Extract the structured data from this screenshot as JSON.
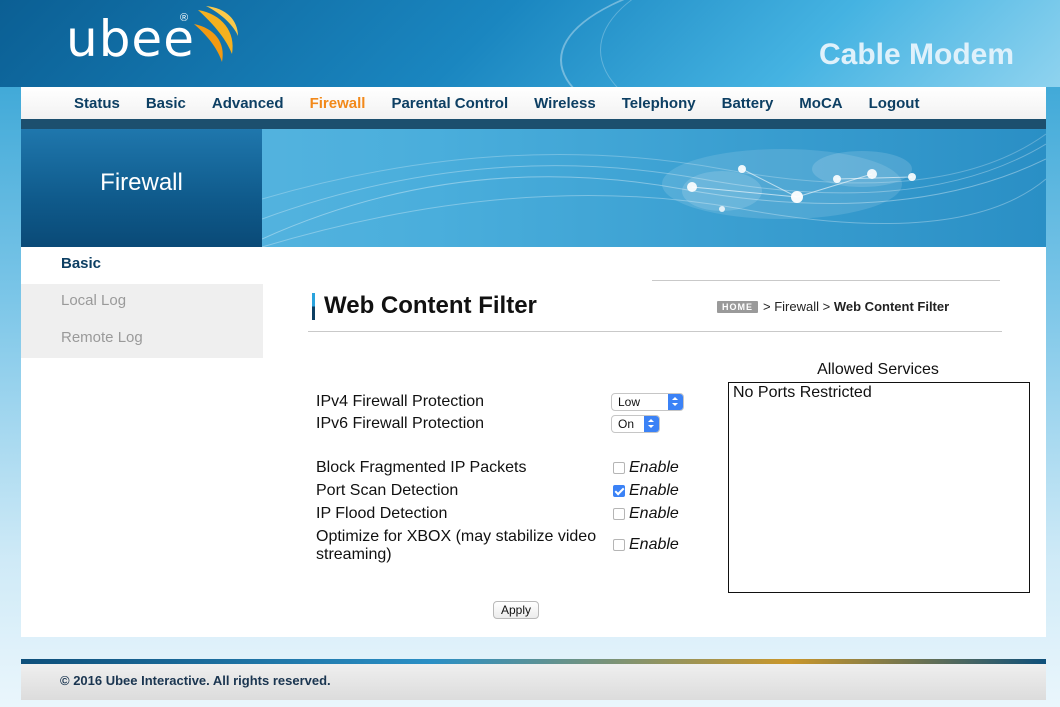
{
  "header": {
    "logo_text": "ubee",
    "logo_reg": "®",
    "product_title": "Cable Modem"
  },
  "nav": {
    "items": [
      {
        "label": "Status",
        "active": false
      },
      {
        "label": "Basic",
        "active": false
      },
      {
        "label": "Advanced",
        "active": false
      },
      {
        "label": "Firewall",
        "active": true
      },
      {
        "label": "Parental Control",
        "active": false
      },
      {
        "label": "Wireless",
        "active": false
      },
      {
        "label": "Telephony",
        "active": false
      },
      {
        "label": "Battery",
        "active": false
      },
      {
        "label": "MoCA",
        "active": false
      },
      {
        "label": "Logout",
        "active": false
      }
    ],
    "active_color": "#f2891a"
  },
  "banner": {
    "section_title": "Firewall"
  },
  "sidebar": {
    "items": [
      {
        "label": "Basic",
        "active": true
      },
      {
        "label": "Local Log",
        "active": false
      },
      {
        "label": "Remote Log",
        "active": false
      }
    ]
  },
  "page": {
    "title": "Web Content Filter",
    "breadcrumb": {
      "home_badge": "HOME",
      "sep1": ">",
      "section": "Firewall",
      "sep2": ">",
      "current": "Web Content Filter"
    }
  },
  "form": {
    "ipv4_label": "IPv4 Firewall Protection",
    "ipv4_value": "Low",
    "ipv6_label": "IPv6 Firewall Protection",
    "ipv6_value": "On",
    "options": [
      {
        "label": "Block Fragmented IP Packets",
        "check_label": "Enable",
        "checked": false
      },
      {
        "label": "Port Scan Detection",
        "check_label": "Enable",
        "checked": true
      },
      {
        "label": "IP Flood Detection",
        "check_label": "Enable",
        "checked": false
      },
      {
        "label": "Optimize for XBOX (may stabilize video streaming)",
        "check_label": "Enable",
        "checked": false
      }
    ],
    "apply_label": "Apply"
  },
  "allowed_services": {
    "title": "Allowed Services",
    "content": "No Ports Restricted"
  },
  "footer": {
    "copyright": "© 2016 Ubee Interactive. All rights reserved."
  }
}
